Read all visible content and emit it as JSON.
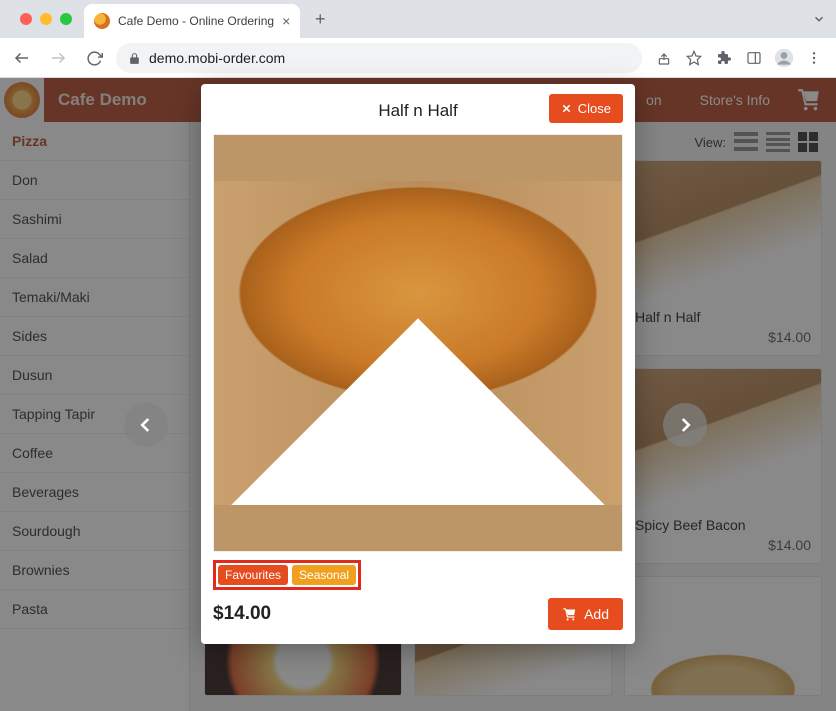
{
  "browser": {
    "tab_title": "Cafe Demo - Online Ordering",
    "url": "demo.mobi-order.com"
  },
  "header": {
    "brand": "Cafe Demo",
    "nav_on": "on",
    "nav_store_info": "Store's Info"
  },
  "sidebar": {
    "items": [
      {
        "label": "Pizza",
        "active": true
      },
      {
        "label": "Don"
      },
      {
        "label": "Sashimi"
      },
      {
        "label": "Salad"
      },
      {
        "label": "Temaki/Maki"
      },
      {
        "label": "Sides"
      },
      {
        "label": "Dusun"
      },
      {
        "label": "Tapping Tapir"
      },
      {
        "label": "Coffee"
      },
      {
        "label": "Beverages"
      },
      {
        "label": "Sourdough"
      },
      {
        "label": "Brownies"
      },
      {
        "label": "Pasta"
      }
    ]
  },
  "content": {
    "view_label": "View:",
    "products": [
      {
        "title": "Half n Half",
        "price": "$14.00"
      },
      {
        "title": "Spicy Beef Bacon",
        "price": "$14.00"
      }
    ]
  },
  "modal": {
    "title": "Half n Half",
    "close_label": "Close",
    "tags": {
      "favourites": "Favourites",
      "seasonal": "Seasonal"
    },
    "price": "$14.00",
    "add_label": "Add"
  }
}
